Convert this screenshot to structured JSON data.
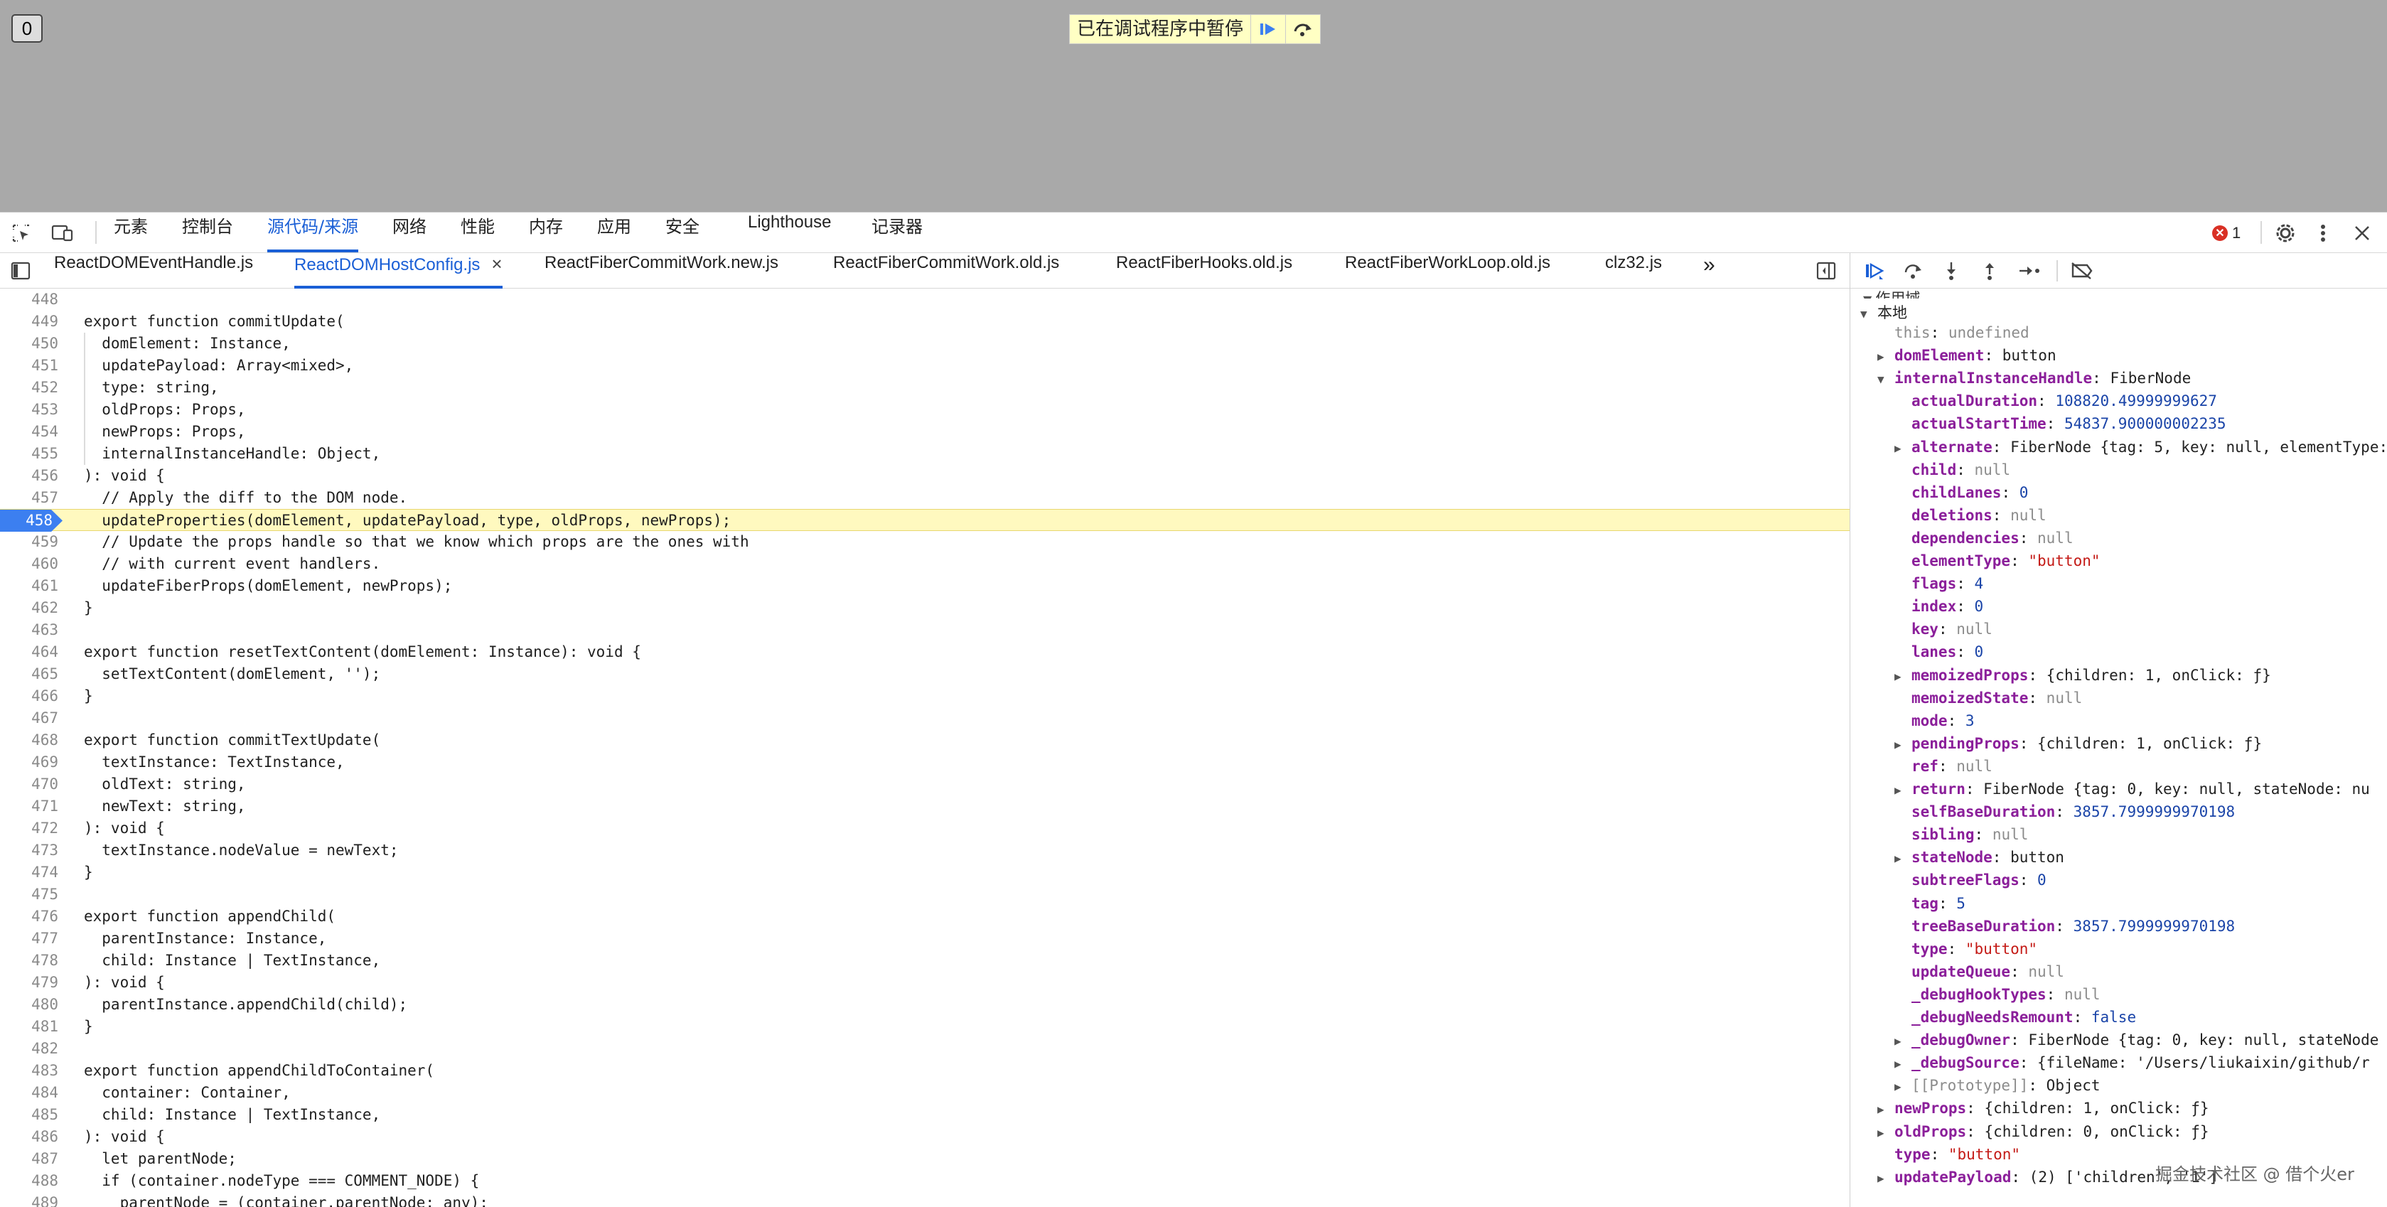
{
  "page": {
    "counter_value": "0",
    "paused_text": "已在调试程序中暂停"
  },
  "panel_tabs": [
    "元素",
    "控制台",
    "源代码/来源",
    "网络",
    "性能",
    "内存",
    "应用",
    "安全",
    "Lighthouse",
    "记录器"
  ],
  "active_panel": "源代码/来源",
  "error_count": "1",
  "file_tabs": [
    "ReactDOMEventHandle.js",
    "ReactDOMHostConfig.js",
    "ReactFiberCommitWork.new.js",
    "ReactFiberCommitWork.old.js",
    "ReactFiberHooks.old.js",
    "ReactFiberWorkLoop.old.js",
    "clz32.js"
  ],
  "active_file": "ReactDOMHostConfig.js",
  "overflow_label": "»",
  "code_lines": [
    {
      "n": "448",
      "t": ""
    },
    {
      "n": "449",
      "t": "export function commitUpdate("
    },
    {
      "n": "450",
      "t": "  domElement: Instance,"
    },
    {
      "n": "451",
      "t": "  updatePayload: Array<mixed>,"
    },
    {
      "n": "452",
      "t": "  type: string,"
    },
    {
      "n": "453",
      "t": "  oldProps: Props,"
    },
    {
      "n": "454",
      "t": "  newProps: Props,"
    },
    {
      "n": "455",
      "t": "  internalInstanceHandle: Object,"
    },
    {
      "n": "456",
      "t": "): void {"
    },
    {
      "n": "457",
      "t": "  // Apply the diff to the DOM node."
    },
    {
      "n": "458",
      "t": "  updateProperties(domElement, updatePayload, type, oldProps, newProps);"
    },
    {
      "n": "459",
      "t": "  // Update the props handle so that we know which props are the ones with"
    },
    {
      "n": "460",
      "t": "  // with current event handlers."
    },
    {
      "n": "461",
      "t": "  updateFiberProps(domElement, newProps);"
    },
    {
      "n": "462",
      "t": "}"
    },
    {
      "n": "463",
      "t": ""
    },
    {
      "n": "464",
      "t": "export function resetTextContent(domElement: Instance): void {"
    },
    {
      "n": "465",
      "t": "  setTextContent(domElement, '');"
    },
    {
      "n": "466",
      "t": "}"
    },
    {
      "n": "467",
      "t": ""
    },
    {
      "n": "468",
      "t": "export function commitTextUpdate("
    },
    {
      "n": "469",
      "t": "  textInstance: TextInstance,"
    },
    {
      "n": "470",
      "t": "  oldText: string,"
    },
    {
      "n": "471",
      "t": "  newText: string,"
    },
    {
      "n": "472",
      "t": "): void {"
    },
    {
      "n": "473",
      "t": "  textInstance.nodeValue = newText;"
    },
    {
      "n": "474",
      "t": "}"
    },
    {
      "n": "475",
      "t": ""
    },
    {
      "n": "476",
      "t": "export function appendChild("
    },
    {
      "n": "477",
      "t": "  parentInstance: Instance,"
    },
    {
      "n": "478",
      "t": "  child: Instance | TextInstance,"
    },
    {
      "n": "479",
      "t": "): void {"
    },
    {
      "n": "480",
      "t": "  parentInstance.appendChild(child);"
    },
    {
      "n": "481",
      "t": "}"
    },
    {
      "n": "482",
      "t": ""
    },
    {
      "n": "483",
      "t": "export function appendChildToContainer("
    },
    {
      "n": "484",
      "t": "  container: Container,"
    },
    {
      "n": "485",
      "t": "  child: Instance | TextInstance,"
    },
    {
      "n": "486",
      "t": "): void {"
    },
    {
      "n": "487",
      "t": "  let parentNode;"
    },
    {
      "n": "488",
      "t": "  if (container.nodeType === COMMENT_NODE) {"
    },
    {
      "n": "489",
      "t": "    parentNode = (container.parentNode: any);"
    }
  ],
  "current_line": "458",
  "scope": {
    "header": "作用域",
    "local_label": "本地",
    "rows": [
      {
        "d": 1,
        "tri": "",
        "k": "this",
        "v": "undefined",
        "c": "vnull",
        "dim": true
      },
      {
        "d": 1,
        "tri": "▶",
        "k": "domElement",
        "v": "button",
        "c": "vobj"
      },
      {
        "d": 1,
        "tri": "▼",
        "k": "internalInstanceHandle",
        "v": "FiberNode",
        "c": "vobj"
      },
      {
        "d": 2,
        "tri": "",
        "k": "actualDuration",
        "v": "108820.49999999627",
        "c": "vnum"
      },
      {
        "d": 2,
        "tri": "",
        "k": "actualStartTime",
        "v": "54837.900000002235",
        "c": "vnum"
      },
      {
        "d": 2,
        "tri": "▶",
        "k": "alternate",
        "v": "FiberNode {tag: 5, key: null, elementType:",
        "c": "vobj"
      },
      {
        "d": 2,
        "tri": "",
        "k": "child",
        "v": "null",
        "c": "vnull"
      },
      {
        "d": 2,
        "tri": "",
        "k": "childLanes",
        "v": "0",
        "c": "vnum"
      },
      {
        "d": 2,
        "tri": "",
        "k": "deletions",
        "v": "null",
        "c": "vnull"
      },
      {
        "d": 2,
        "tri": "",
        "k": "dependencies",
        "v": "null",
        "c": "vnull"
      },
      {
        "d": 2,
        "tri": "",
        "k": "elementType",
        "v": "\"button\"",
        "c": "vstr"
      },
      {
        "d": 2,
        "tri": "",
        "k": "flags",
        "v": "4",
        "c": "vnum"
      },
      {
        "d": 2,
        "tri": "",
        "k": "index",
        "v": "0",
        "c": "vnum"
      },
      {
        "d": 2,
        "tri": "",
        "k": "key",
        "v": "null",
        "c": "vnull"
      },
      {
        "d": 2,
        "tri": "",
        "k": "lanes",
        "v": "0",
        "c": "vnum"
      },
      {
        "d": 2,
        "tri": "▶",
        "k": "memoizedProps",
        "v": "{children: 1, onClick: ƒ}",
        "c": "vobj"
      },
      {
        "d": 2,
        "tri": "",
        "k": "memoizedState",
        "v": "null",
        "c": "vnull"
      },
      {
        "d": 2,
        "tri": "",
        "k": "mode",
        "v": "3",
        "c": "vnum"
      },
      {
        "d": 2,
        "tri": "▶",
        "k": "pendingProps",
        "v": "{children: 1, onClick: ƒ}",
        "c": "vobj"
      },
      {
        "d": 2,
        "tri": "",
        "k": "ref",
        "v": "null",
        "c": "vnull"
      },
      {
        "d": 2,
        "tri": "▶",
        "k": "return",
        "v": "FiberNode {tag: 0, key: null, stateNode: nu",
        "c": "vobj"
      },
      {
        "d": 2,
        "tri": "",
        "k": "selfBaseDuration",
        "v": "3857.7999999970198",
        "c": "vnum"
      },
      {
        "d": 2,
        "tri": "",
        "k": "sibling",
        "v": "null",
        "c": "vnull"
      },
      {
        "d": 2,
        "tri": "▶",
        "k": "stateNode",
        "v": "button",
        "c": "vobj"
      },
      {
        "d": 2,
        "tri": "",
        "k": "subtreeFlags",
        "v": "0",
        "c": "vnum"
      },
      {
        "d": 2,
        "tri": "",
        "k": "tag",
        "v": "5",
        "c": "vnum"
      },
      {
        "d": 2,
        "tri": "",
        "k": "treeBaseDuration",
        "v": "3857.7999999970198",
        "c": "vnum"
      },
      {
        "d": 2,
        "tri": "",
        "k": "type",
        "v": "\"button\"",
        "c": "vstr"
      },
      {
        "d": 2,
        "tri": "",
        "k": "updateQueue",
        "v": "null",
        "c": "vnull"
      },
      {
        "d": 2,
        "tri": "",
        "k": "_debugHookTypes",
        "v": "null",
        "c": "vnull"
      },
      {
        "d": 2,
        "tri": "",
        "k": "_debugNeedsRemount",
        "v": "false",
        "c": "vnum"
      },
      {
        "d": 2,
        "tri": "▶",
        "k": "_debugOwner",
        "v": "FiberNode {tag: 0, key: null, stateNode",
        "c": "vobj"
      },
      {
        "d": 2,
        "tri": "▶",
        "k": "_debugSource",
        "v": "{fileName: '/Users/liukaixin/github/r",
        "c": "vobj"
      },
      {
        "d": 2,
        "tri": "▶",
        "k": "[[Prototype]]",
        "v": "Object",
        "c": "vobj",
        "dim": true
      },
      {
        "d": 1,
        "tri": "▶",
        "k": "newProps",
        "v": "{children: 1, onClick: ƒ}",
        "c": "vobj"
      },
      {
        "d": 1,
        "tri": "▶",
        "k": "oldProps",
        "v": "{children: 0, onClick: ƒ}",
        "c": "vobj"
      },
      {
        "d": 1,
        "tri": "",
        "k": "type",
        "v": "\"button\"",
        "c": "vstr"
      },
      {
        "d": 1,
        "tri": "▶",
        "k": "updatePayload",
        "v": "(2) ['children', '1']",
        "c": "vobj"
      }
    ]
  },
  "watermark": "掘金技术社区 @ 借个火er",
  "colors": {
    "accent": "#1a5fd6",
    "current_line_bg": "#fff9bf",
    "breakpoint": "#3c7ff0",
    "error": "#d93025"
  }
}
